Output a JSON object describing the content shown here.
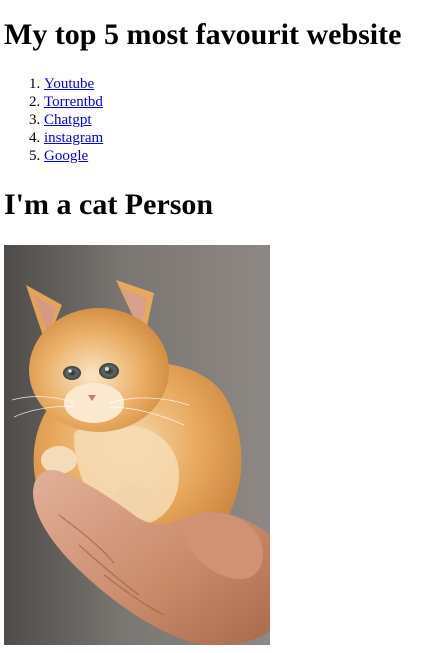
{
  "heading": "My top 5 most favourit website",
  "sites": [
    {
      "label": "Youtube"
    },
    {
      "label": "Torrentbd"
    },
    {
      "label": "Chatgpt"
    },
    {
      "label": "instagram"
    },
    {
      "label": "Google"
    }
  ],
  "subheading": "I'm a cat Person",
  "photo": {
    "subject": "orange kitten held in a hand",
    "colors": {
      "background": "#6f6b67",
      "fur": "#e6a55c",
      "hand": "#c98a6a"
    }
  }
}
